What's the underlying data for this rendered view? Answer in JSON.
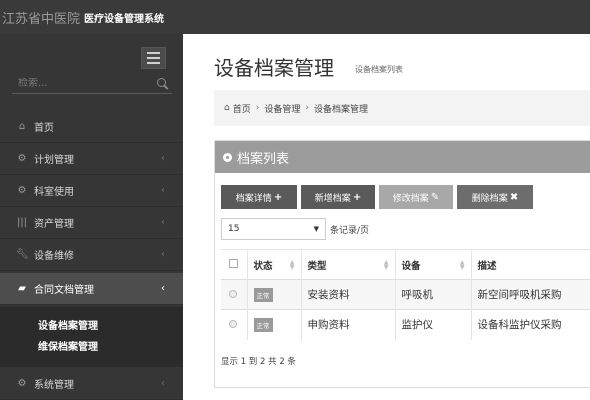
{
  "topbar": {
    "hospital_name": "江苏省中医院",
    "system_name": "医疗设备管理系统"
  },
  "sidebar": {
    "search_placeholder": "检索...",
    "items": [
      {
        "label": "首页",
        "icon": "home-icon",
        "arrow": ""
      },
      {
        "label": "计划管理",
        "icon": "gears-icon",
        "arrow": "‹"
      },
      {
        "label": "科室使用",
        "icon": "gears-icon",
        "arrow": "‹"
      },
      {
        "label": "资产管理",
        "icon": "barcode-icon",
        "arrow": "‹"
      },
      {
        "label": "设备维修",
        "icon": "wrench-icon",
        "arrow": "‹"
      },
      {
        "label": "合同文档管理",
        "icon": "folder-open-icon",
        "arrow": "‹"
      },
      {
        "label": "系统管理",
        "icon": "gears-icon",
        "arrow": "‹"
      }
    ],
    "submenu": [
      "设备档案管理",
      "维保档案管理"
    ]
  },
  "main": {
    "title": "设备档案管理",
    "subtitle": "设备档案列表",
    "breadcrumb": [
      "首页",
      "设备管理",
      "设备档案管理"
    ],
    "panel_title": "档案列表",
    "buttons": {
      "detail": "档案详情",
      "add": "新增档案",
      "edit": "修改档案",
      "delete": "删除档案"
    },
    "page_size": "15",
    "per_page_label": "条记录/页",
    "table": {
      "headers": [
        "状态",
        "类型",
        "设备",
        "描述"
      ],
      "rows": [
        {
          "status": "正常",
          "type": "安装资料",
          "device": "呼吸机",
          "desc": "新空间呼吸机采购"
        },
        {
          "status": "正常",
          "type": "申购资料",
          "device": "监护仪",
          "desc": "设备科监护仪采购"
        }
      ]
    },
    "footer": "显示 1 到 2 共 2 条"
  }
}
